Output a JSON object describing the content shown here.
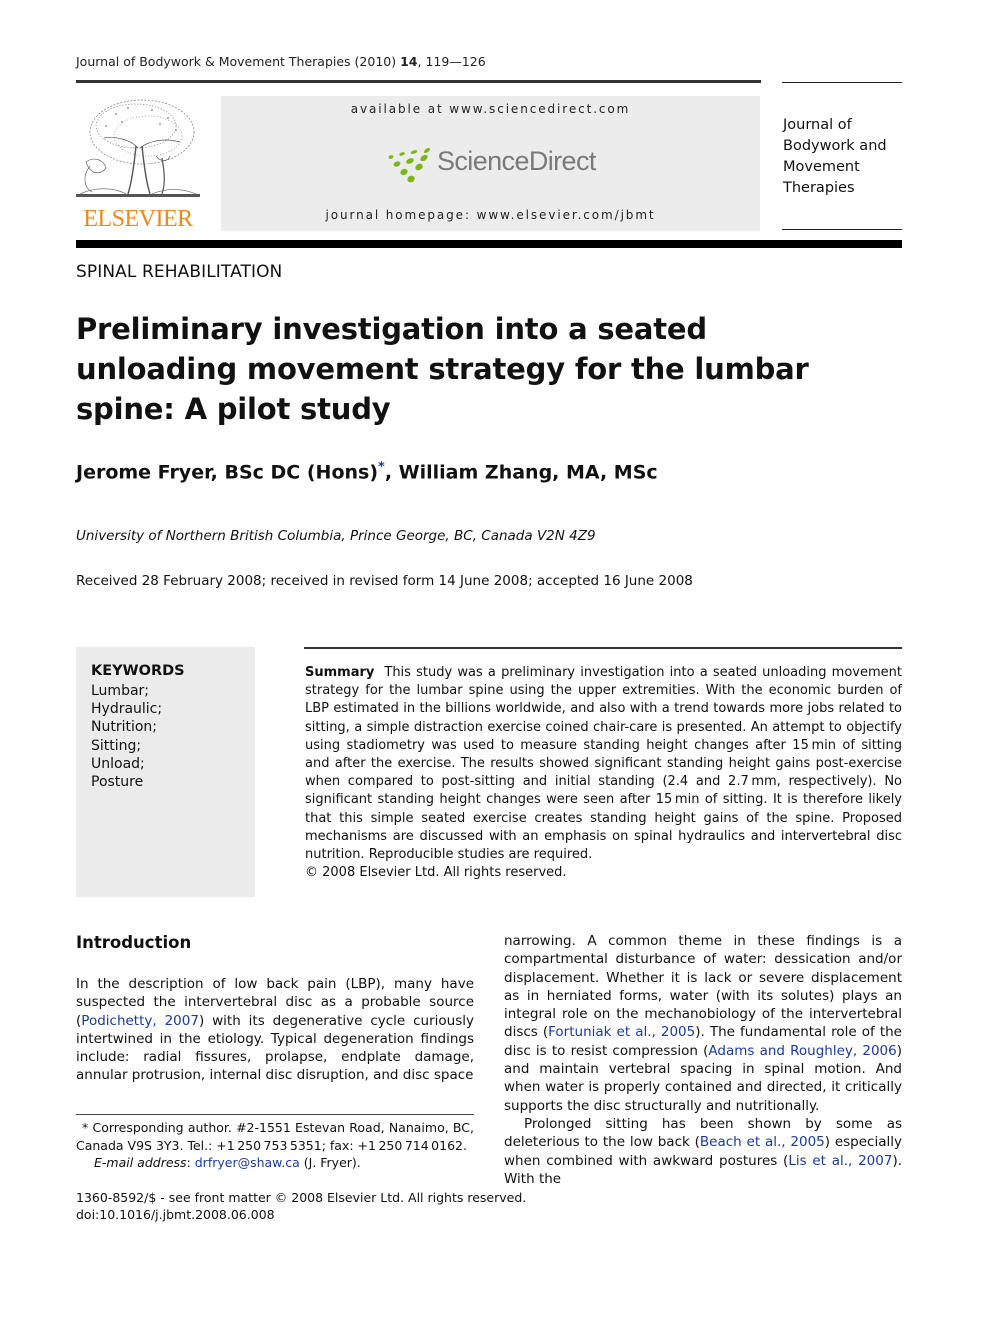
{
  "header": {
    "running_head_prefix": "Journal of Bodywork & Movement Therapies (2010) ",
    "running_head_volume": "14",
    "running_head_pages": ", 119—126",
    "publisher_logo_text": "ELSEVIER",
    "available_at": "available at www.sciencedirect.com",
    "sciencedirect_logo_text": "ScienceDirect",
    "journal_homepage": "journal homepage: www.elsevier.com/jbmt",
    "journal_name_lines": [
      "Journal of",
      "Bodywork and",
      "Movement",
      "Therapies"
    ],
    "colors": {
      "elsevier_orange": "#f0861e",
      "sciencedirect_green": "#7cb518",
      "link_blue": "#1a3aa0"
    }
  },
  "article": {
    "section": "SPINAL REHABILITATION",
    "title": "Preliminary investigation into a seated unloading movement strategy for the lumbar spine: A pilot study",
    "authors_part1": "Jerome Fryer, BSc DC (Hons)",
    "author_mark": "*",
    "authors_part2": ", William Zhang, MA, MSc",
    "affiliation": "University of Northern British Columbia, Prince George, BC, Canada V2N 4Z9",
    "dates": "Received 28 February 2008; received in revised form 14 June 2008; accepted 16 June 2008"
  },
  "keywords": {
    "title": "KEYWORDS",
    "items": [
      "Lumbar;",
      "Hydraulic;",
      "Nutrition;",
      "Sitting;",
      "Unload;",
      "Posture"
    ]
  },
  "abstract": {
    "label": "Summary",
    "text": "This study was a preliminary investigation into a seated unloading movement strategy for the lumbar spine using the upper extremities. With the economic burden of LBP estimated in the billions worldwide, and also with a trend towards more jobs related to sitting, a simple distraction exercise coined chair-care is presented. An attempt to objectify using stadiometry was used to measure standing height changes after 15 min of sitting and after the exercise. The results showed significant standing height gains post-exercise when compared to post-sitting and initial standing (2.4 and 2.7 mm, respectively). No significant standing height changes were seen after 15 min of sitting. It is therefore likely that this simple seated exercise creates standing height gains of the spine. Proposed mechanisms are discussed with an emphasis on spinal hydraulics and intervertebral disc nutrition. Reproducible studies are required.",
    "copyright": "© 2008 Elsevier Ltd. All rights reserved."
  },
  "introduction": {
    "heading": "Introduction",
    "left_p1_a": "In the description of low back pain (LBP), many have suspected the intervertebral disc as a probable source (",
    "left_cite1": "Podichetty, 2007",
    "left_p1_b": ") with its degenerative cycle curiously intertwined in the etiology. Typical degeneration findings include: radial fissures, prolapse, endplate damage, annular protrusion, internal disc disruption, and disc space",
    "right_p1_a": "narrowing. A common theme in these findings is a compartmental disturbance of water: dessication and/or displacement. Whether it is lack or severe displacement as in herniated forms, water (with its solutes) plays an integral role on the mechanobiology of the intervertebral discs (",
    "right_cite1": "Fortuniak et al., 2005",
    "right_p1_b": "). The fundamental role of the disc is to resist compression (",
    "right_cite2": "Adams and Roughley, 2006",
    "right_p1_c": ") and maintain vertebral spacing in spinal motion. And when water is properly contained and directed, it critically supports the disc structurally and nutritionally.",
    "right_p2_a": "Prolonged sitting has been shown by some as deleterious to the low back (",
    "right_cite3": "Beach et al., 2005",
    "right_p2_b": ") especially when combined with awkward postures (",
    "right_cite4": "Lis et al., 2007",
    "right_p2_c": "). With the"
  },
  "footnote": {
    "line1": "* Corresponding author. #2-1551 Estevan Road, Nanaimo, BC, Canada V9S 3Y3. Tel.: +1 250 753 5351; fax: +1 250 714 0162.",
    "email_label": "E-mail address",
    "email_sep": ": ",
    "email": "drfryer@shaw.ca",
    "email_suffix": " (J. Fryer)."
  },
  "bottom": {
    "front_matter": "1360-8592/$ - see front matter © 2008 Elsevier Ltd. All rights reserved.",
    "doi": "doi:10.1016/j.jbmt.2008.06.008"
  }
}
